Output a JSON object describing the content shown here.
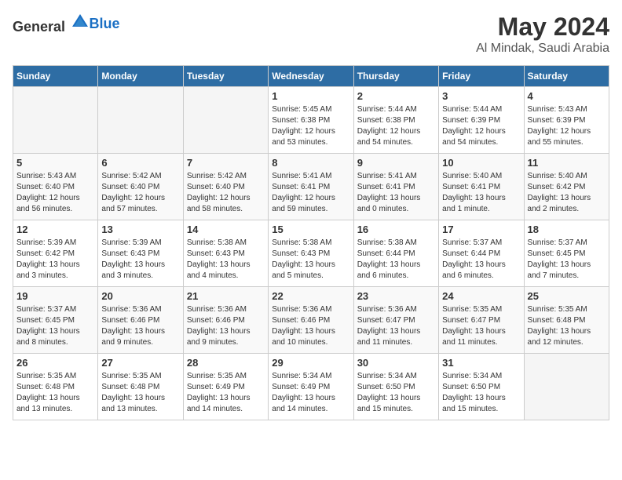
{
  "header": {
    "logo_general": "General",
    "logo_blue": "Blue",
    "month": "May 2024",
    "location": "Al Mindak, Saudi Arabia"
  },
  "weekdays": [
    "Sunday",
    "Monday",
    "Tuesday",
    "Wednesday",
    "Thursday",
    "Friday",
    "Saturday"
  ],
  "weeks": [
    [
      {
        "day": "",
        "empty": true
      },
      {
        "day": "",
        "empty": true
      },
      {
        "day": "",
        "empty": true
      },
      {
        "day": "1",
        "lines": [
          "Sunrise: 5:45 AM",
          "Sunset: 6:38 PM",
          "Daylight: 12 hours",
          "and 53 minutes."
        ]
      },
      {
        "day": "2",
        "lines": [
          "Sunrise: 5:44 AM",
          "Sunset: 6:38 PM",
          "Daylight: 12 hours",
          "and 54 minutes."
        ]
      },
      {
        "day": "3",
        "lines": [
          "Sunrise: 5:44 AM",
          "Sunset: 6:39 PM",
          "Daylight: 12 hours",
          "and 54 minutes."
        ]
      },
      {
        "day": "4",
        "lines": [
          "Sunrise: 5:43 AM",
          "Sunset: 6:39 PM",
          "Daylight: 12 hours",
          "and 55 minutes."
        ]
      }
    ],
    [
      {
        "day": "5",
        "lines": [
          "Sunrise: 5:43 AM",
          "Sunset: 6:40 PM",
          "Daylight: 12 hours",
          "and 56 minutes."
        ]
      },
      {
        "day": "6",
        "lines": [
          "Sunrise: 5:42 AM",
          "Sunset: 6:40 PM",
          "Daylight: 12 hours",
          "and 57 minutes."
        ]
      },
      {
        "day": "7",
        "lines": [
          "Sunrise: 5:42 AM",
          "Sunset: 6:40 PM",
          "Daylight: 12 hours",
          "and 58 minutes."
        ]
      },
      {
        "day": "8",
        "lines": [
          "Sunrise: 5:41 AM",
          "Sunset: 6:41 PM",
          "Daylight: 12 hours",
          "and 59 minutes."
        ]
      },
      {
        "day": "9",
        "lines": [
          "Sunrise: 5:41 AM",
          "Sunset: 6:41 PM",
          "Daylight: 13 hours",
          "and 0 minutes."
        ]
      },
      {
        "day": "10",
        "lines": [
          "Sunrise: 5:40 AM",
          "Sunset: 6:41 PM",
          "Daylight: 13 hours",
          "and 1 minute."
        ]
      },
      {
        "day": "11",
        "lines": [
          "Sunrise: 5:40 AM",
          "Sunset: 6:42 PM",
          "Daylight: 13 hours",
          "and 2 minutes."
        ]
      }
    ],
    [
      {
        "day": "12",
        "lines": [
          "Sunrise: 5:39 AM",
          "Sunset: 6:42 PM",
          "Daylight: 13 hours",
          "and 3 minutes."
        ]
      },
      {
        "day": "13",
        "lines": [
          "Sunrise: 5:39 AM",
          "Sunset: 6:43 PM",
          "Daylight: 13 hours",
          "and 3 minutes."
        ]
      },
      {
        "day": "14",
        "lines": [
          "Sunrise: 5:38 AM",
          "Sunset: 6:43 PM",
          "Daylight: 13 hours",
          "and 4 minutes."
        ]
      },
      {
        "day": "15",
        "lines": [
          "Sunrise: 5:38 AM",
          "Sunset: 6:43 PM",
          "Daylight: 13 hours",
          "and 5 minutes."
        ]
      },
      {
        "day": "16",
        "lines": [
          "Sunrise: 5:38 AM",
          "Sunset: 6:44 PM",
          "Daylight: 13 hours",
          "and 6 minutes."
        ]
      },
      {
        "day": "17",
        "lines": [
          "Sunrise: 5:37 AM",
          "Sunset: 6:44 PM",
          "Daylight: 13 hours",
          "and 6 minutes."
        ]
      },
      {
        "day": "18",
        "lines": [
          "Sunrise: 5:37 AM",
          "Sunset: 6:45 PM",
          "Daylight: 13 hours",
          "and 7 minutes."
        ]
      }
    ],
    [
      {
        "day": "19",
        "lines": [
          "Sunrise: 5:37 AM",
          "Sunset: 6:45 PM",
          "Daylight: 13 hours",
          "and 8 minutes."
        ]
      },
      {
        "day": "20",
        "lines": [
          "Sunrise: 5:36 AM",
          "Sunset: 6:46 PM",
          "Daylight: 13 hours",
          "and 9 minutes."
        ]
      },
      {
        "day": "21",
        "lines": [
          "Sunrise: 5:36 AM",
          "Sunset: 6:46 PM",
          "Daylight: 13 hours",
          "and 9 minutes."
        ]
      },
      {
        "day": "22",
        "lines": [
          "Sunrise: 5:36 AM",
          "Sunset: 6:46 PM",
          "Daylight: 13 hours",
          "and 10 minutes."
        ]
      },
      {
        "day": "23",
        "lines": [
          "Sunrise: 5:36 AM",
          "Sunset: 6:47 PM",
          "Daylight: 13 hours",
          "and 11 minutes."
        ]
      },
      {
        "day": "24",
        "lines": [
          "Sunrise: 5:35 AM",
          "Sunset: 6:47 PM",
          "Daylight: 13 hours",
          "and 11 minutes."
        ]
      },
      {
        "day": "25",
        "lines": [
          "Sunrise: 5:35 AM",
          "Sunset: 6:48 PM",
          "Daylight: 13 hours",
          "and 12 minutes."
        ]
      }
    ],
    [
      {
        "day": "26",
        "lines": [
          "Sunrise: 5:35 AM",
          "Sunset: 6:48 PM",
          "Daylight: 13 hours",
          "and 13 minutes."
        ]
      },
      {
        "day": "27",
        "lines": [
          "Sunrise: 5:35 AM",
          "Sunset: 6:48 PM",
          "Daylight: 13 hours",
          "and 13 minutes."
        ]
      },
      {
        "day": "28",
        "lines": [
          "Sunrise: 5:35 AM",
          "Sunset: 6:49 PM",
          "Daylight: 13 hours",
          "and 14 minutes."
        ]
      },
      {
        "day": "29",
        "lines": [
          "Sunrise: 5:34 AM",
          "Sunset: 6:49 PM",
          "Daylight: 13 hours",
          "and 14 minutes."
        ]
      },
      {
        "day": "30",
        "lines": [
          "Sunrise: 5:34 AM",
          "Sunset: 6:50 PM",
          "Daylight: 13 hours",
          "and 15 minutes."
        ]
      },
      {
        "day": "31",
        "lines": [
          "Sunrise: 5:34 AM",
          "Sunset: 6:50 PM",
          "Daylight: 13 hours",
          "and 15 minutes."
        ]
      },
      {
        "day": "",
        "empty": true
      }
    ]
  ]
}
